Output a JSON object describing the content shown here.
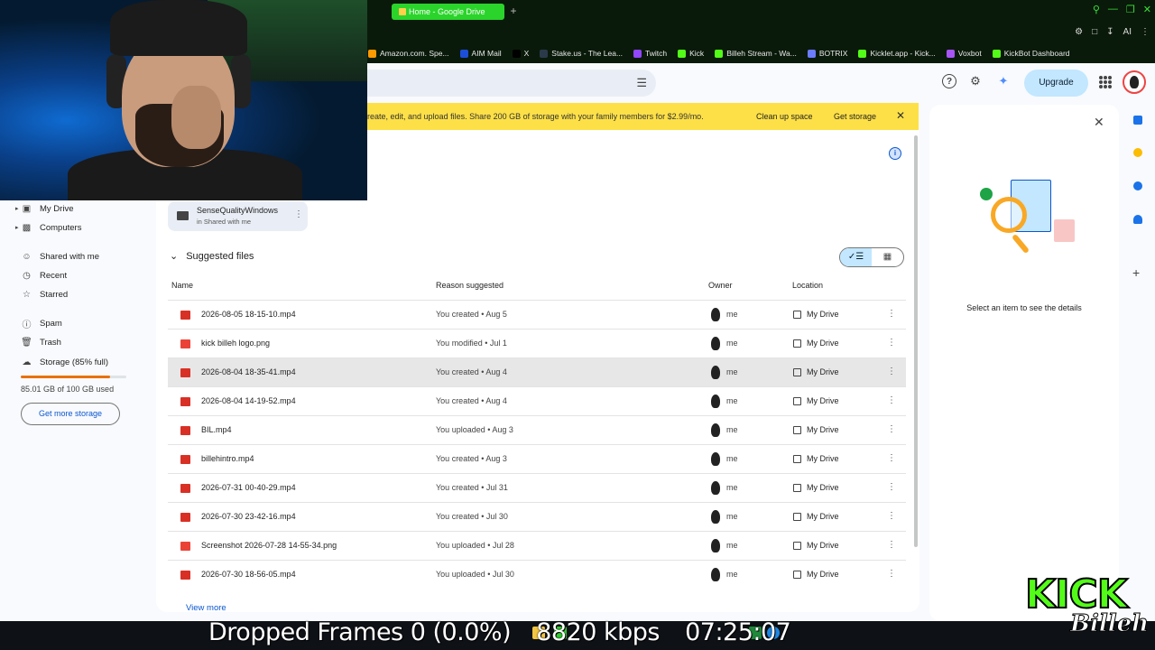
{
  "browser": {
    "active_tab": "Home - Google Drive",
    "new_tab": "+",
    "bookmarks": [
      {
        "label": "Amazon.com. Spe...",
        "color": "#ff9900"
      },
      {
        "label": "AIM Mail",
        "color": "#1d4ed8"
      },
      {
        "label": "X",
        "color": "#000000"
      },
      {
        "label": "Stake.us - The Lea...",
        "color": "#2b3a4a"
      },
      {
        "label": "Twitch",
        "color": "#9146ff"
      },
      {
        "label": "Kick",
        "color": "#53fc18"
      },
      {
        "label": "Billeh Stream - Wa...",
        "color": "#53fc18"
      },
      {
        "label": "BOTRIX",
        "color": "#6b7cff"
      },
      {
        "label": "Kicklet.app - Kick...",
        "color": "#53fc18"
      },
      {
        "label": "Voxbot",
        "color": "#a855f7"
      },
      {
        "label": "KickBot Dashboard",
        "color": "#53fc18"
      }
    ],
    "ai_label": "AI"
  },
  "header": {
    "upgrade_label": "Upgrade"
  },
  "banner": {
    "text": "reate, edit, and upload files. Share 200 GB of storage with your family members for $2.99/mo.",
    "clean_label": "Clean up space",
    "get_storage_label": "Get storage"
  },
  "sidebar": {
    "items": [
      {
        "label": "My Drive",
        "icon": "drive-icon"
      },
      {
        "label": "Computers",
        "icon": "computer-icon"
      },
      {
        "label": "Shared with me",
        "icon": "people-icon"
      },
      {
        "label": "Recent",
        "icon": "clock-icon"
      },
      {
        "label": "Starred",
        "icon": "star-icon"
      },
      {
        "label": "Spam",
        "icon": "spam-icon"
      },
      {
        "label": "Trash",
        "icon": "trash-icon"
      },
      {
        "label": "Storage (85% full)",
        "icon": "cloud-icon"
      }
    ],
    "storage_used": "85.01 GB of 100 GB used",
    "storage_fraction": 0.85,
    "get_more_label": "Get more storage"
  },
  "folder": {
    "name": "SenseQualityWindows",
    "sub": "in Shared with me"
  },
  "suggested": {
    "title": "Suggested files",
    "columns": {
      "name": "Name",
      "reason": "Reason suggested",
      "owner": "Owner",
      "location": "Location"
    },
    "rows": [
      {
        "name": "2026-08-05 18-15-10.mp4",
        "reason": "You created • Aug 5",
        "owner": "me",
        "location": "My Drive",
        "type": "video"
      },
      {
        "name": "kick billeh logo.png",
        "reason": "You modified • Jul 1",
        "owner": "me",
        "location": "My Drive",
        "type": "image"
      },
      {
        "name": "2026-08-04 18-35-41.mp4",
        "reason": "You created • Aug 4",
        "owner": "me",
        "location": "My Drive",
        "type": "video"
      },
      {
        "name": "2026-08-04 14-19-52.mp4",
        "reason": "You created • Aug 4",
        "owner": "me",
        "location": "My Drive",
        "type": "video"
      },
      {
        "name": "BIL.mp4",
        "reason": "You uploaded • Aug 3",
        "owner": "me",
        "location": "My Drive",
        "type": "video"
      },
      {
        "name": "billehintro.mp4",
        "reason": "You created • Aug 3",
        "owner": "me",
        "location": "My Drive",
        "type": "video"
      },
      {
        "name": "2026-07-31 00-40-29.mp4",
        "reason": "You created • Jul 31",
        "owner": "me",
        "location": "My Drive",
        "type": "video"
      },
      {
        "name": "2026-07-30 23-42-16.mp4",
        "reason": "You created • Jul 30",
        "owner": "me",
        "location": "My Drive",
        "type": "video"
      },
      {
        "name": "Screenshot 2026-07-28 14-55-34.png",
        "reason": "You uploaded • Jul 28",
        "owner": "me",
        "location": "My Drive",
        "type": "image"
      },
      {
        "name": "2026-07-30 18-56-05.mp4",
        "reason": "You uploaded • Jul 30",
        "owner": "me",
        "location": "My Drive",
        "type": "video"
      }
    ],
    "view_more": "View more"
  },
  "details": {
    "message": "Select an item to see the details"
  },
  "stream_stats": {
    "dropped_frames": "Dropped Frames 0 (0.0%)",
    "bitrate": "8820 kbps",
    "time": "07:25:07"
  },
  "overlay": {
    "logo_word": "KICK",
    "logo_signature": "Billeh"
  }
}
